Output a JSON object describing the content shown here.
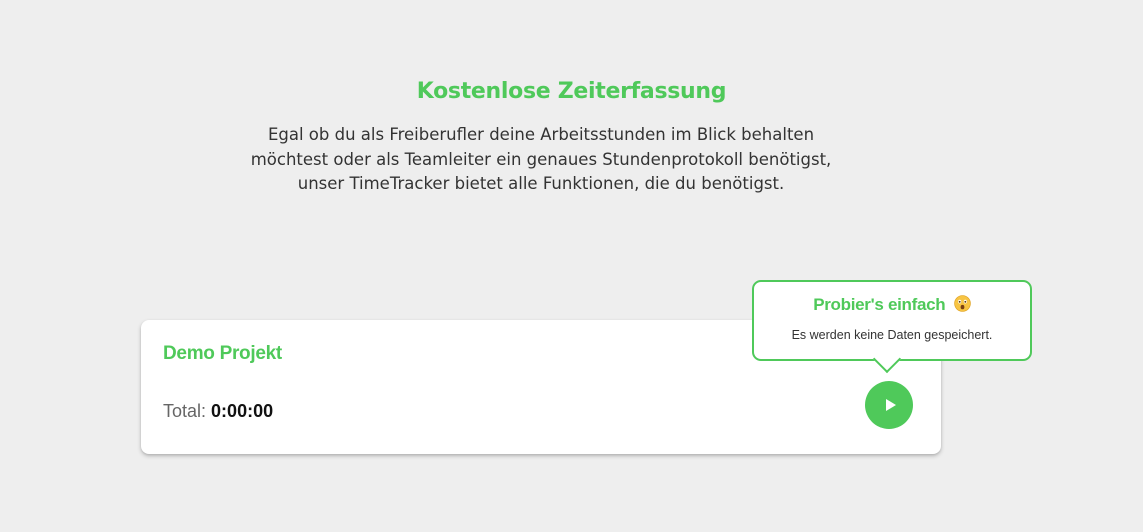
{
  "hero": {
    "title": "Kostenlose Zeiterfassung",
    "text_lines": [
      "Egal ob du als Freiberufler deine Arbeitsstunden im Blick behalten",
      "möchtest oder als Teamleiter ein genaues Stundenprotokoll benötigst,",
      "unser TimeTracker bietet alle Funktionen, die du benötigst."
    ]
  },
  "card": {
    "project_name": "Demo Projekt",
    "total_label": "Total:",
    "total_value": "0:00:00",
    "play_icon": "play-icon"
  },
  "tooltip": {
    "title": "Probier's einfach",
    "emoji_icon": "astonished-face-emoji",
    "text": "Es werden keine Daten gespeichert."
  },
  "colors": {
    "background": "#eeeeee",
    "accent": "#4fc95a",
    "card": "#ffffff",
    "text": "#333333"
  }
}
